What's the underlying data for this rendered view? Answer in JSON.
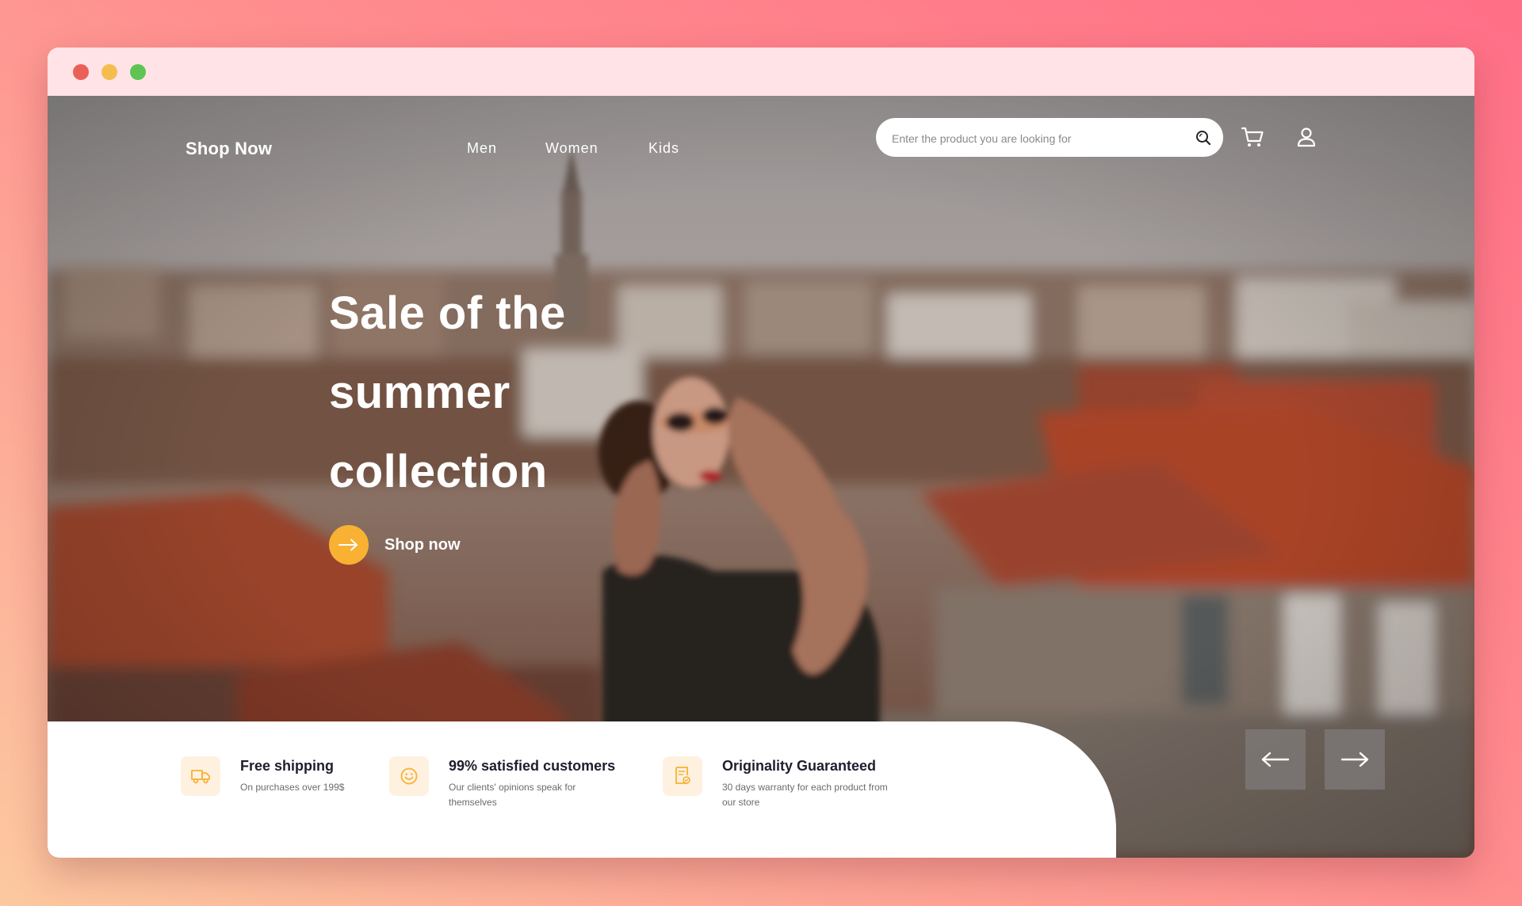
{
  "nav": {
    "logo": "Shop Now",
    "links": [
      {
        "label": "Men"
      },
      {
        "label": "Women"
      },
      {
        "label": "Kids"
      }
    ],
    "search": {
      "placeholder": "Enter the product you are looking for",
      "value": "",
      "icon": "search-icon"
    },
    "cart_icon": "cart-icon",
    "user_icon": "user-icon"
  },
  "hero": {
    "headline_lines": [
      "Sale of the",
      "summer",
      "collection"
    ],
    "cta_label": "Shop now",
    "cta_icon": "arrow-right-icon",
    "accent_color": "#f8b132"
  },
  "features": [
    {
      "title": "Free shipping",
      "description": "On purchases over 199$",
      "icon": "truck-icon"
    },
    {
      "title": "99% satisfied customers",
      "description": "Our clients' opinions speak for themselves",
      "icon": "smiley-icon"
    },
    {
      "title": "Originality Guaranteed",
      "description": "30 days warranty for each product from our store",
      "icon": "certificate-icon"
    }
  ],
  "slider": {
    "prev_icon": "arrow-left-icon",
    "next_icon": "arrow-right-icon"
  },
  "window_controls": [
    "close",
    "minimize",
    "maximize"
  ]
}
